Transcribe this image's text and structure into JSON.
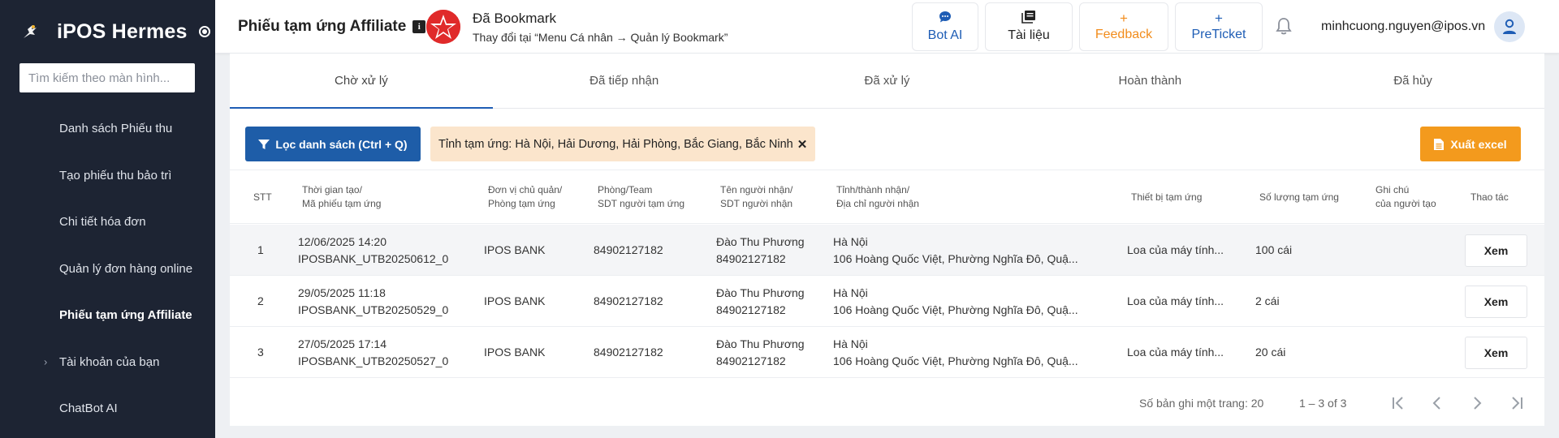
{
  "sidebar": {
    "brand": "iPOS Hermes",
    "search_placeholder": "Tìm kiếm theo màn hình...",
    "items": [
      {
        "label": "Danh sách Phiếu thu"
      },
      {
        "label": "Tạo phiếu thu bảo trì"
      },
      {
        "label": "Chi tiết hóa đơn"
      },
      {
        "label": "Quản lý đơn hàng online"
      },
      {
        "label": "Phiếu tạm ứng Affiliate",
        "active": true
      },
      {
        "label": "Tài khoản của bạn",
        "expandable": true
      },
      {
        "label": "ChatBot AI"
      }
    ]
  },
  "header": {
    "title": "Phiếu tạm ứng Affiliate",
    "bookmark_title": "Đã Bookmark",
    "bookmark_hint": "Thay đổi tại “Menu Cá nhân → Quản lý Bookmark”",
    "buttons": {
      "bot_ai": "Bot AI",
      "docs": "Tài liệu",
      "feedback": "Feedback",
      "preticket": "PreTicket"
    },
    "user_email": "minhcuong.nguyen@ipos.vn"
  },
  "tabs": [
    "Chờ xử lý",
    "Đã tiếp nhận",
    "Đã xử lý",
    "Hoàn thành",
    "Đã hủy"
  ],
  "toolbar": {
    "filter_label": "Lọc danh sách (Ctrl + Q)",
    "chip_label": "Tỉnh tạm ứng: Hà Nội, Hải Dương, Hải Phòng, Bắc Giang, Bắc Ninh",
    "excel_label": "Xuất excel"
  },
  "table": {
    "headers": {
      "stt": "STT",
      "time_1": "Thời gian tạo/",
      "time_2": "Mã phiếu tạm ứng",
      "unit_1": "Đơn vị chủ quản/",
      "unit_2": "Phòng tạm ứng",
      "team_1": "Phòng/Team",
      "team_2": "SDT người tạm ứng",
      "recv_1": "Tên người nhận/",
      "recv_2": "SDT người nhận",
      "prov_1": "Tỉnh/thành nhận/",
      "prov_2": "Địa chỉ người nhận",
      "device": "Thiết bị tạm ứng",
      "qty": "Số lượng tạm ứng",
      "note_1": "Ghi chú",
      "note_2": "của người tạo",
      "action": "Thao tác"
    },
    "rows": [
      {
        "stt": "1",
        "time": "12/06/2025 14:20",
        "code": "IPOSBANK_UTB20250612_0",
        "unit": "IPOS BANK",
        "phone": "84902127182",
        "name": "Đào Thu Phương",
        "recv_phone": "84902127182",
        "province": "Hà Nội",
        "address": "106 Hoàng Quốc Việt, Phường Nghĩa Đô, Quậ...",
        "device": "Loa của máy tính...",
        "qty": "100 cái",
        "action": "Xem"
      },
      {
        "stt": "2",
        "time": "29/05/2025 11:18",
        "code": "IPOSBANK_UTB20250529_0",
        "unit": "IPOS BANK",
        "phone": "84902127182",
        "name": "Đào Thu Phương",
        "recv_phone": "84902127182",
        "province": "Hà Nội",
        "address": "106 Hoàng Quốc Việt, Phường Nghĩa Đô, Quậ...",
        "device": "Loa của máy tính...",
        "qty": "2 cái",
        "action": "Xem"
      },
      {
        "stt": "3",
        "time": "27/05/2025 17:14",
        "code": "IPOSBANK_UTB20250527_0",
        "unit": "IPOS BANK",
        "phone": "84902127182",
        "name": "Đào Thu Phương",
        "recv_phone": "84902127182",
        "province": "Hà Nội",
        "address": "106 Hoàng Quốc Việt, Phường Nghĩa Đô, Quậ...",
        "device": "Loa của máy tính...",
        "qty": "20 cái",
        "action": "Xem"
      }
    ]
  },
  "pagination": {
    "page_size_label": "Số bản ghi một trang: 20",
    "range": "1 – 3 of 3"
  },
  "colors": {
    "sidebar_bg": "#1d2433",
    "primary": "#1e5da8",
    "accent_orange": "#f39a1d",
    "chip_bg": "#fbe5cc"
  }
}
